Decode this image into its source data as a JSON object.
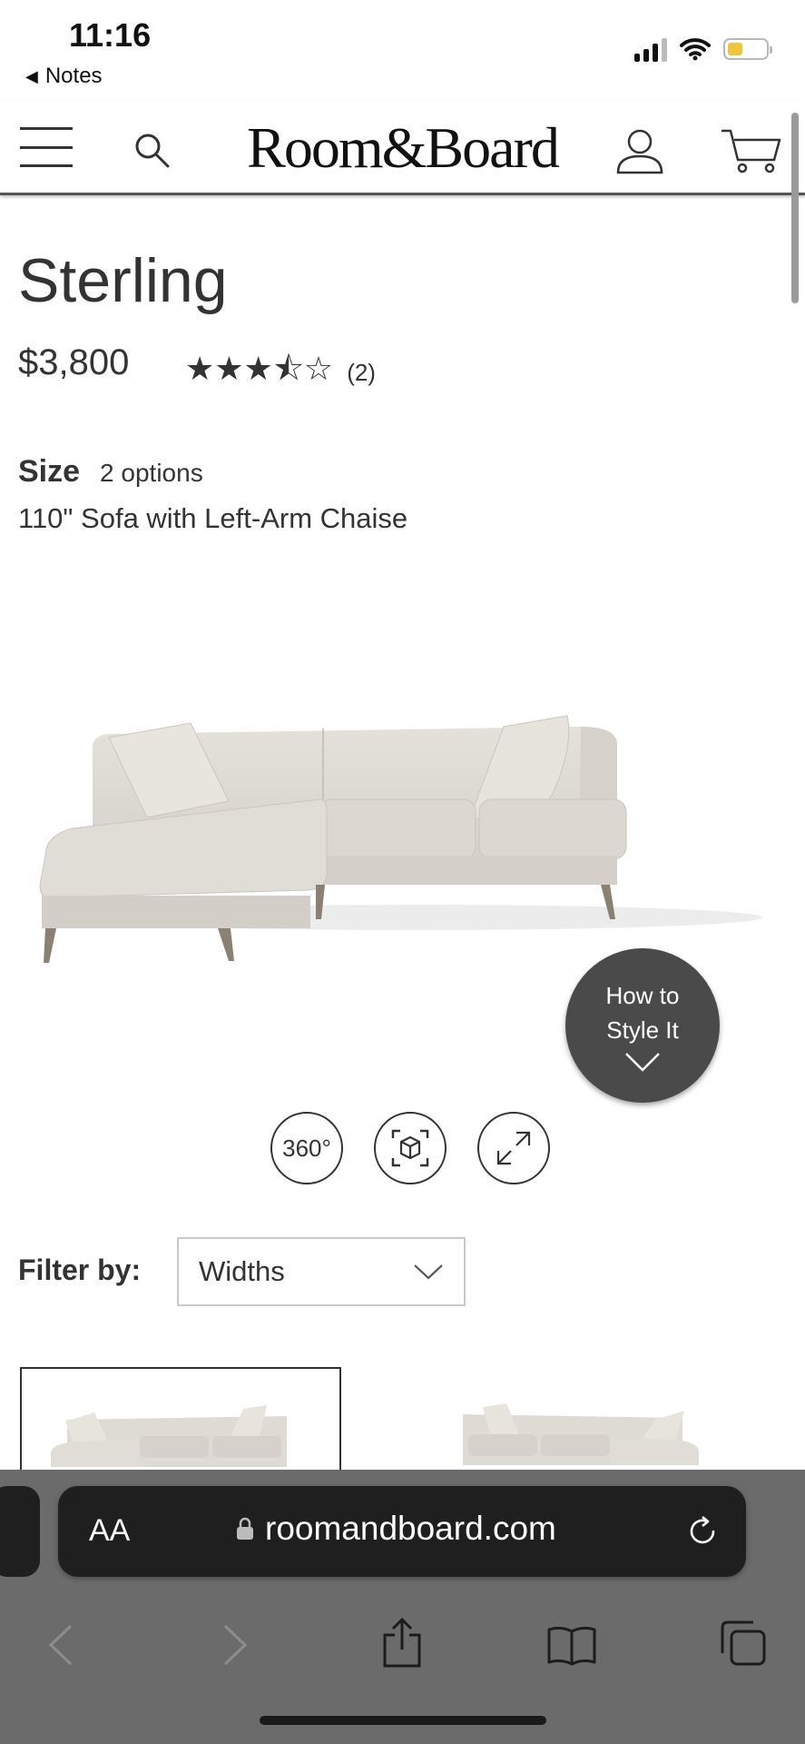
{
  "status_bar": {
    "time": "11:16",
    "back_label": "Notes"
  },
  "header": {
    "logo": "Room&Board"
  },
  "product": {
    "title": "Sterling",
    "price": "$3,800",
    "rating": 3.5,
    "rating_stars": "★★★⯪☆",
    "review_count": "(2)",
    "size_label": "Size",
    "size_options": "2 options",
    "size_value": "110\" Sofa with Left-Arm Chaise"
  },
  "style_button": {
    "line1": "How to",
    "line2": "Style It"
  },
  "view_controls": {
    "rotate_label": "360°"
  },
  "filter": {
    "label": "Filter by:",
    "selected": "Widths"
  },
  "browser": {
    "text_size": "AA",
    "url": "roomandboard.com"
  },
  "colors": {
    "sofa": "#dedbd5",
    "style_button": "#4a4a4a",
    "browser_bar": "#6b6b6b"
  }
}
